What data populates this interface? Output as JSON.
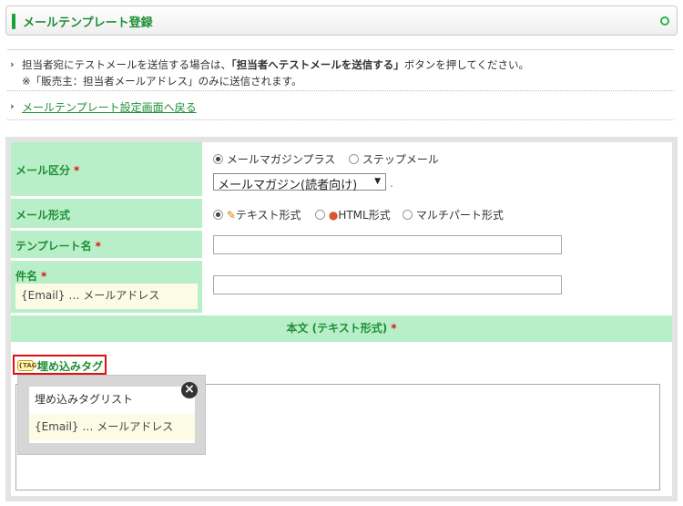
{
  "header": {
    "title": "メールテンプレート登録"
  },
  "info": {
    "line1_pre": "担当者宛にテストメールを送信する場合は、",
    "line1_bold": "「担当者へテストメールを送信する」",
    "line1_post": "ボタンを押してください。",
    "line2": "※「販売主：担当者メールアドレス」のみに送信されます。",
    "back_link": "メールテンプレート設定画面へ戻る"
  },
  "form": {
    "mail_category": {
      "label": "メール区分",
      "required": "*",
      "options": [
        "メールマガジンプラス",
        "ステップメール"
      ],
      "selected_index": 0,
      "select_value": "メールマガジン(読者向け)",
      "trailing": "."
    },
    "mail_format": {
      "label": "メール形式",
      "options": [
        "テキスト形式",
        "HTML形式",
        "マルチパート形式"
      ],
      "selected_index": 0
    },
    "template_name": {
      "label": "テンプレート名",
      "required": "*",
      "value": ""
    },
    "subject": {
      "label": "件名",
      "required": "*",
      "hint": "{Email} … メールアドレス",
      "value": ""
    },
    "body": {
      "header": "本文 (テキスト形式)",
      "required": "*",
      "tag_button": "埋め込みタグ",
      "tag_icon_text": "{TAG}",
      "value": ""
    },
    "tag_popup": {
      "title": "埋め込みタグリスト",
      "items": [
        "{Email} … メールアドレス"
      ],
      "close_symbol": "×"
    }
  },
  "colors": {
    "accent_green": "#1e8f36",
    "label_bg": "#b8efc8",
    "required_red": "#e01010",
    "hint_bg": "#fbfbe6"
  },
  "icons": {
    "text_format": "pencil-icon",
    "html_format": "palette-icon",
    "tag": "tag-icon",
    "close": "close-icon",
    "back": "chevron-right-icon"
  }
}
